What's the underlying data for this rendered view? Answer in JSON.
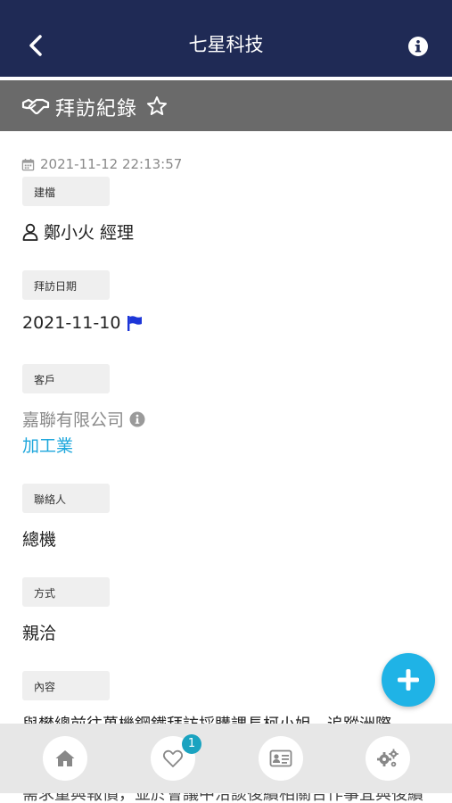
{
  "header": {
    "title": "七星科技",
    "back_icon": "chevron-left-icon",
    "info_icon": "info-circle-icon",
    "background": "#1f2a55"
  },
  "section": {
    "title": "拜訪紀錄",
    "icon": "handshake-icon",
    "favorite_icon": "star-outline-icon",
    "background": "#6a6a6a"
  },
  "record": {
    "timestamp": "2021-11-12 22:13:57",
    "fields": [
      {
        "label": "建檔",
        "value": "鄭小火 經理"
      },
      {
        "label": "拜訪日期",
        "value": "2021-11-10"
      },
      {
        "label": "客戶",
        "value": "嘉聯有限公司",
        "sub": "加工業"
      },
      {
        "label": "聯絡人",
        "value": "總機"
      },
      {
        "label": "方式",
        "value": "親洽"
      },
      {
        "label": "內容",
        "value": "與樊總前往萬機鋼鐵拜訪採購課長柯小姐，追蹤洲際"
      }
    ],
    "content_more": "需求量與報價，並於會議中洽談後續相關合作事宜與後續"
  },
  "fab": {
    "icon": "plus-icon",
    "color": "#1fb3e6"
  },
  "bottom_nav": {
    "items": [
      {
        "icon": "home-icon"
      },
      {
        "icon": "heart-icon",
        "badge": "1"
      },
      {
        "icon": "id-card-icon"
      },
      {
        "icon": "gears-icon"
      }
    ]
  }
}
